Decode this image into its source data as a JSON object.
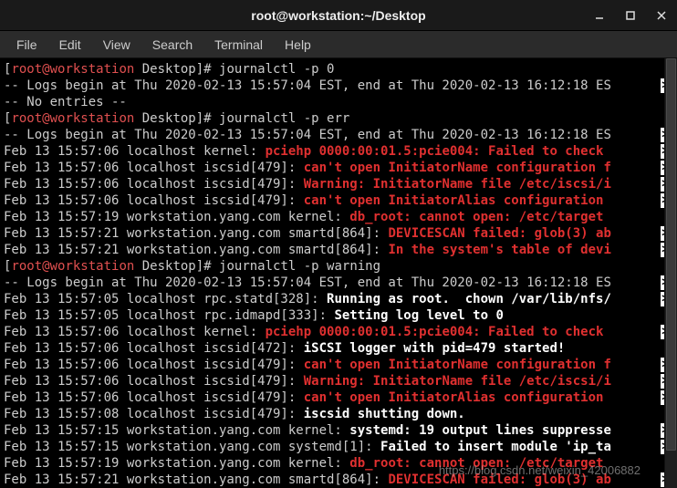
{
  "window": {
    "title": "root@workstation:~/Desktop"
  },
  "menu": {
    "file": "File",
    "edit": "Edit",
    "view": "View",
    "search": "Search",
    "terminal": "Terminal",
    "help": "Help"
  },
  "prompt": {
    "open": "[",
    "user": "root@workstation",
    "path": " Desktop",
    "close": "]# "
  },
  "lines": [
    {
      "segments": [
        {
          "type": "prompt"
        },
        {
          "cls": "plain",
          "text": "journalctl -p 0"
        }
      ]
    },
    {
      "segments": [
        {
          "cls": "plain",
          "text": "-- Logs begin at Thu 2020-02-13 15:57:04 EST, end at Thu 2020-02-13 16:12:18 ES"
        }
      ],
      "overflow": true
    },
    {
      "segments": [
        {
          "cls": "plain",
          "text": "-- No entries --"
        }
      ]
    },
    {
      "segments": [
        {
          "type": "prompt"
        },
        {
          "cls": "plain",
          "text": "journalctl -p err"
        }
      ]
    },
    {
      "segments": [
        {
          "cls": "plain",
          "text": "-- Logs begin at Thu 2020-02-13 15:57:04 EST, end at Thu 2020-02-13 16:12:18 ES"
        }
      ],
      "overflow": true
    },
    {
      "segments": [
        {
          "cls": "plain",
          "text": "Feb 13 15:57:06 localhost kernel: "
        },
        {
          "cls": "bold-red",
          "text": "pciehp 0000:00:01.5:pcie004: Failed to check "
        }
      ],
      "overflow": true
    },
    {
      "segments": [
        {
          "cls": "plain",
          "text": "Feb 13 15:57:06 localhost iscsid[479]: "
        },
        {
          "cls": "bold-red",
          "text": "can't open InitiatorName configuration f"
        }
      ],
      "overflow": true
    },
    {
      "segments": [
        {
          "cls": "plain",
          "text": "Feb 13 15:57:06 localhost iscsid[479]: "
        },
        {
          "cls": "bold-red",
          "text": "Warning: InitiatorName file /etc/iscsi/i"
        }
      ],
      "overflow": true
    },
    {
      "segments": [
        {
          "cls": "plain",
          "text": "Feb 13 15:57:06 localhost iscsid[479]: "
        },
        {
          "cls": "bold-red",
          "text": "can't open InitiatorAlias configuration "
        }
      ],
      "overflow": true
    },
    {
      "segments": [
        {
          "cls": "plain",
          "text": "Feb 13 15:57:19 workstation.yang.com kernel: "
        },
        {
          "cls": "bold-red",
          "text": "db_root: cannot open: /etc/target"
        }
      ]
    },
    {
      "segments": [
        {
          "cls": "plain",
          "text": "Feb 13 15:57:21 workstation.yang.com smartd[864]: "
        },
        {
          "cls": "bold-red",
          "text": "DEVICESCAN failed: glob(3) ab"
        }
      ],
      "overflow": true
    },
    {
      "segments": [
        {
          "cls": "plain",
          "text": "Feb 13 15:57:21 workstation.yang.com smartd[864]: "
        },
        {
          "cls": "bold-red",
          "text": "In the system's table of devi"
        }
      ],
      "overflow": true
    },
    {
      "segments": [
        {
          "type": "prompt"
        },
        {
          "cls": "plain",
          "text": "journalctl -p warning"
        }
      ]
    },
    {
      "segments": [
        {
          "cls": "plain",
          "text": "-- Logs begin at Thu 2020-02-13 15:57:04 EST, end at Thu 2020-02-13 16:12:18 ES"
        }
      ],
      "overflow": true
    },
    {
      "segments": [
        {
          "cls": "plain",
          "text": "Feb 13 15:57:05 localhost rpc.statd[328]: "
        },
        {
          "cls": "bold-white",
          "text": "Running as root.  chown /var/lib/nfs/"
        }
      ],
      "overflow": true
    },
    {
      "segments": [
        {
          "cls": "plain",
          "text": "Feb 13 15:57:05 localhost rpc.idmapd[333]: "
        },
        {
          "cls": "bold-white",
          "text": "Setting log level to 0"
        }
      ]
    },
    {
      "segments": [
        {
          "cls": "plain",
          "text": "Feb 13 15:57:06 localhost kernel: "
        },
        {
          "cls": "bold-red",
          "text": "pciehp 0000:00:01.5:pcie004: Failed to check "
        }
      ],
      "overflow": true
    },
    {
      "segments": [
        {
          "cls": "plain",
          "text": "Feb 13 15:57:06 localhost iscsid[472]: "
        },
        {
          "cls": "bold-white",
          "text": "iSCSI logger with pid=479 started!"
        }
      ]
    },
    {
      "segments": [
        {
          "cls": "plain",
          "text": "Feb 13 15:57:06 localhost iscsid[479]: "
        },
        {
          "cls": "bold-red",
          "text": "can't open InitiatorName configuration f"
        }
      ],
      "overflow": true
    },
    {
      "segments": [
        {
          "cls": "plain",
          "text": "Feb 13 15:57:06 localhost iscsid[479]: "
        },
        {
          "cls": "bold-red",
          "text": "Warning: InitiatorName file /etc/iscsi/i"
        }
      ],
      "overflow": true
    },
    {
      "segments": [
        {
          "cls": "plain",
          "text": "Feb 13 15:57:06 localhost iscsid[479]: "
        },
        {
          "cls": "bold-red",
          "text": "can't open InitiatorAlias configuration "
        }
      ],
      "overflow": true
    },
    {
      "segments": [
        {
          "cls": "plain",
          "text": "Feb 13 15:57:08 localhost iscsid[479]: "
        },
        {
          "cls": "bold-white",
          "text": "iscsid shutting down."
        }
      ]
    },
    {
      "segments": [
        {
          "cls": "plain",
          "text": "Feb 13 15:57:15 workstation.yang.com kernel: "
        },
        {
          "cls": "bold-white",
          "text": "systemd: 19 output lines suppresse"
        }
      ],
      "overflow": true
    },
    {
      "segments": [
        {
          "cls": "plain",
          "text": "Feb 13 15:57:15 workstation.yang.com systemd[1]: "
        },
        {
          "cls": "bold-white",
          "text": "Failed to insert module 'ip_ta"
        }
      ],
      "overflow": true
    },
    {
      "segments": [
        {
          "cls": "plain",
          "text": "Feb 13 15:57:19 workstation.yang.com kernel: "
        },
        {
          "cls": "bold-red",
          "text": "db_root: cannot open: /etc/target"
        }
      ]
    },
    {
      "segments": [
        {
          "cls": "plain",
          "text": "Feb 13 15:57:21 workstation.yang.com smartd[864]: "
        },
        {
          "cls": "bold-red",
          "text": "DEVICESCAN failed: glob(3) ab"
        }
      ],
      "overflow": true
    }
  ],
  "watermark": "https://blog.csdn.net/weixin_42006882"
}
